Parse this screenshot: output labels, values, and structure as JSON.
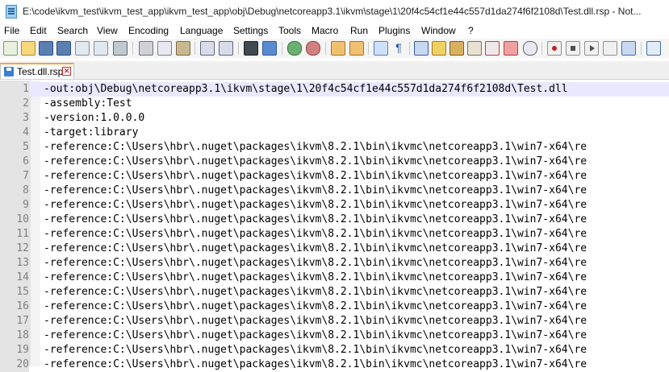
{
  "window": {
    "title": "E:\\code\\ikvm_test\\ikvm_test_app\\ikvm_test_app\\obj\\Debug\\netcoreapp3.1\\ikvm\\stage\\1\\20f4c54cf1e44c557d1da274f6f2108d\\Test.dll.rsp - Not..."
  },
  "menu": {
    "items": [
      "File",
      "Edit",
      "Search",
      "View",
      "Encoding",
      "Language",
      "Settings",
      "Tools",
      "Macro",
      "Run",
      "Plugins",
      "Window",
      "?"
    ]
  },
  "toolbar": {
    "buttons": [
      "new-file-icon",
      "open-file-icon",
      "save-icon",
      "save-all-icon",
      "close-icon",
      "close-all-icon",
      "print-icon",
      "cut-icon",
      "copy-icon",
      "paste-icon",
      "undo-icon",
      "redo-icon",
      "find-icon",
      "replace-icon",
      "zoom-in-icon",
      "zoom-out-icon",
      "sync-vertical-icon",
      "sync-horizontal-icon",
      "word-wrap-icon",
      "show-all-characters-icon",
      "indent-guide-icon",
      "document-map-icon",
      "function-list-icon",
      "folder-as-workspace-icon",
      "document-list-icon",
      "monitoring-icon",
      "start-recording-icon",
      "stop-recording-icon",
      "playback-icon",
      "run-macro-multiple-icon",
      "save-macro-icon",
      "spellcheck-icon"
    ]
  },
  "tab": {
    "label": "Test.dll.rsp"
  },
  "editor": {
    "lines": [
      {
        "num": "1",
        "text": "-out:obj\\Debug\\netcoreapp3.1\\ikvm\\stage\\1\\20f4c54cf1e44c557d1da274f6f2108d\\Test.dll"
      },
      {
        "num": "2",
        "text": "-assembly:Test"
      },
      {
        "num": "3",
        "text": "-version:1.0.0.0"
      },
      {
        "num": "4",
        "text": "-target:library"
      },
      {
        "num": "5",
        "text": "-reference:C:\\Users\\hbr\\.nuget\\packages\\ikvm\\8.2.1\\bin\\ikvmc\\netcoreapp3.1\\win7-x64\\re"
      },
      {
        "num": "6",
        "text": "-reference:C:\\Users\\hbr\\.nuget\\packages\\ikvm\\8.2.1\\bin\\ikvmc\\netcoreapp3.1\\win7-x64\\re"
      },
      {
        "num": "7",
        "text": "-reference:C:\\Users\\hbr\\.nuget\\packages\\ikvm\\8.2.1\\bin\\ikvmc\\netcoreapp3.1\\win7-x64\\re"
      },
      {
        "num": "8",
        "text": "-reference:C:\\Users\\hbr\\.nuget\\packages\\ikvm\\8.2.1\\bin\\ikvmc\\netcoreapp3.1\\win7-x64\\re"
      },
      {
        "num": "9",
        "text": "-reference:C:\\Users\\hbr\\.nuget\\packages\\ikvm\\8.2.1\\bin\\ikvmc\\netcoreapp3.1\\win7-x64\\re"
      },
      {
        "num": "10",
        "text": "-reference:C:\\Users\\hbr\\.nuget\\packages\\ikvm\\8.2.1\\bin\\ikvmc\\netcoreapp3.1\\win7-x64\\re"
      },
      {
        "num": "11",
        "text": "-reference:C:\\Users\\hbr\\.nuget\\packages\\ikvm\\8.2.1\\bin\\ikvmc\\netcoreapp3.1\\win7-x64\\re"
      },
      {
        "num": "12",
        "text": "-reference:C:\\Users\\hbr\\.nuget\\packages\\ikvm\\8.2.1\\bin\\ikvmc\\netcoreapp3.1\\win7-x64\\re"
      },
      {
        "num": "13",
        "text": "-reference:C:\\Users\\hbr\\.nuget\\packages\\ikvm\\8.2.1\\bin\\ikvmc\\netcoreapp3.1\\win7-x64\\re"
      },
      {
        "num": "14",
        "text": "-reference:C:\\Users\\hbr\\.nuget\\packages\\ikvm\\8.2.1\\bin\\ikvmc\\netcoreapp3.1\\win7-x64\\re"
      },
      {
        "num": "15",
        "text": "-reference:C:\\Users\\hbr\\.nuget\\packages\\ikvm\\8.2.1\\bin\\ikvmc\\netcoreapp3.1\\win7-x64\\re"
      },
      {
        "num": "16",
        "text": "-reference:C:\\Users\\hbr\\.nuget\\packages\\ikvm\\8.2.1\\bin\\ikvmc\\netcoreapp3.1\\win7-x64\\re"
      },
      {
        "num": "17",
        "text": "-reference:C:\\Users\\hbr\\.nuget\\packages\\ikvm\\8.2.1\\bin\\ikvmc\\netcoreapp3.1\\win7-x64\\re"
      },
      {
        "num": "18",
        "text": "-reference:C:\\Users\\hbr\\.nuget\\packages\\ikvm\\8.2.1\\bin\\ikvmc\\netcoreapp3.1\\win7-x64\\re"
      },
      {
        "num": "19",
        "text": "-reference:C:\\Users\\hbr\\.nuget\\packages\\ikvm\\8.2.1\\bin\\ikvmc\\netcoreapp3.1\\win7-x64\\re"
      },
      {
        "num": "20",
        "text": "-reference:C:\\Users\\hbr\\.nuget\\packages\\ikvm\\8.2.1\\bin\\ikvmc\\netcoreapp3.1\\win7-x64\\re"
      }
    ]
  },
  "colors": {
    "current_line": "#e8e8ff",
    "gutter": "#e4e4e4",
    "tab_accent": "#f5a442"
  }
}
